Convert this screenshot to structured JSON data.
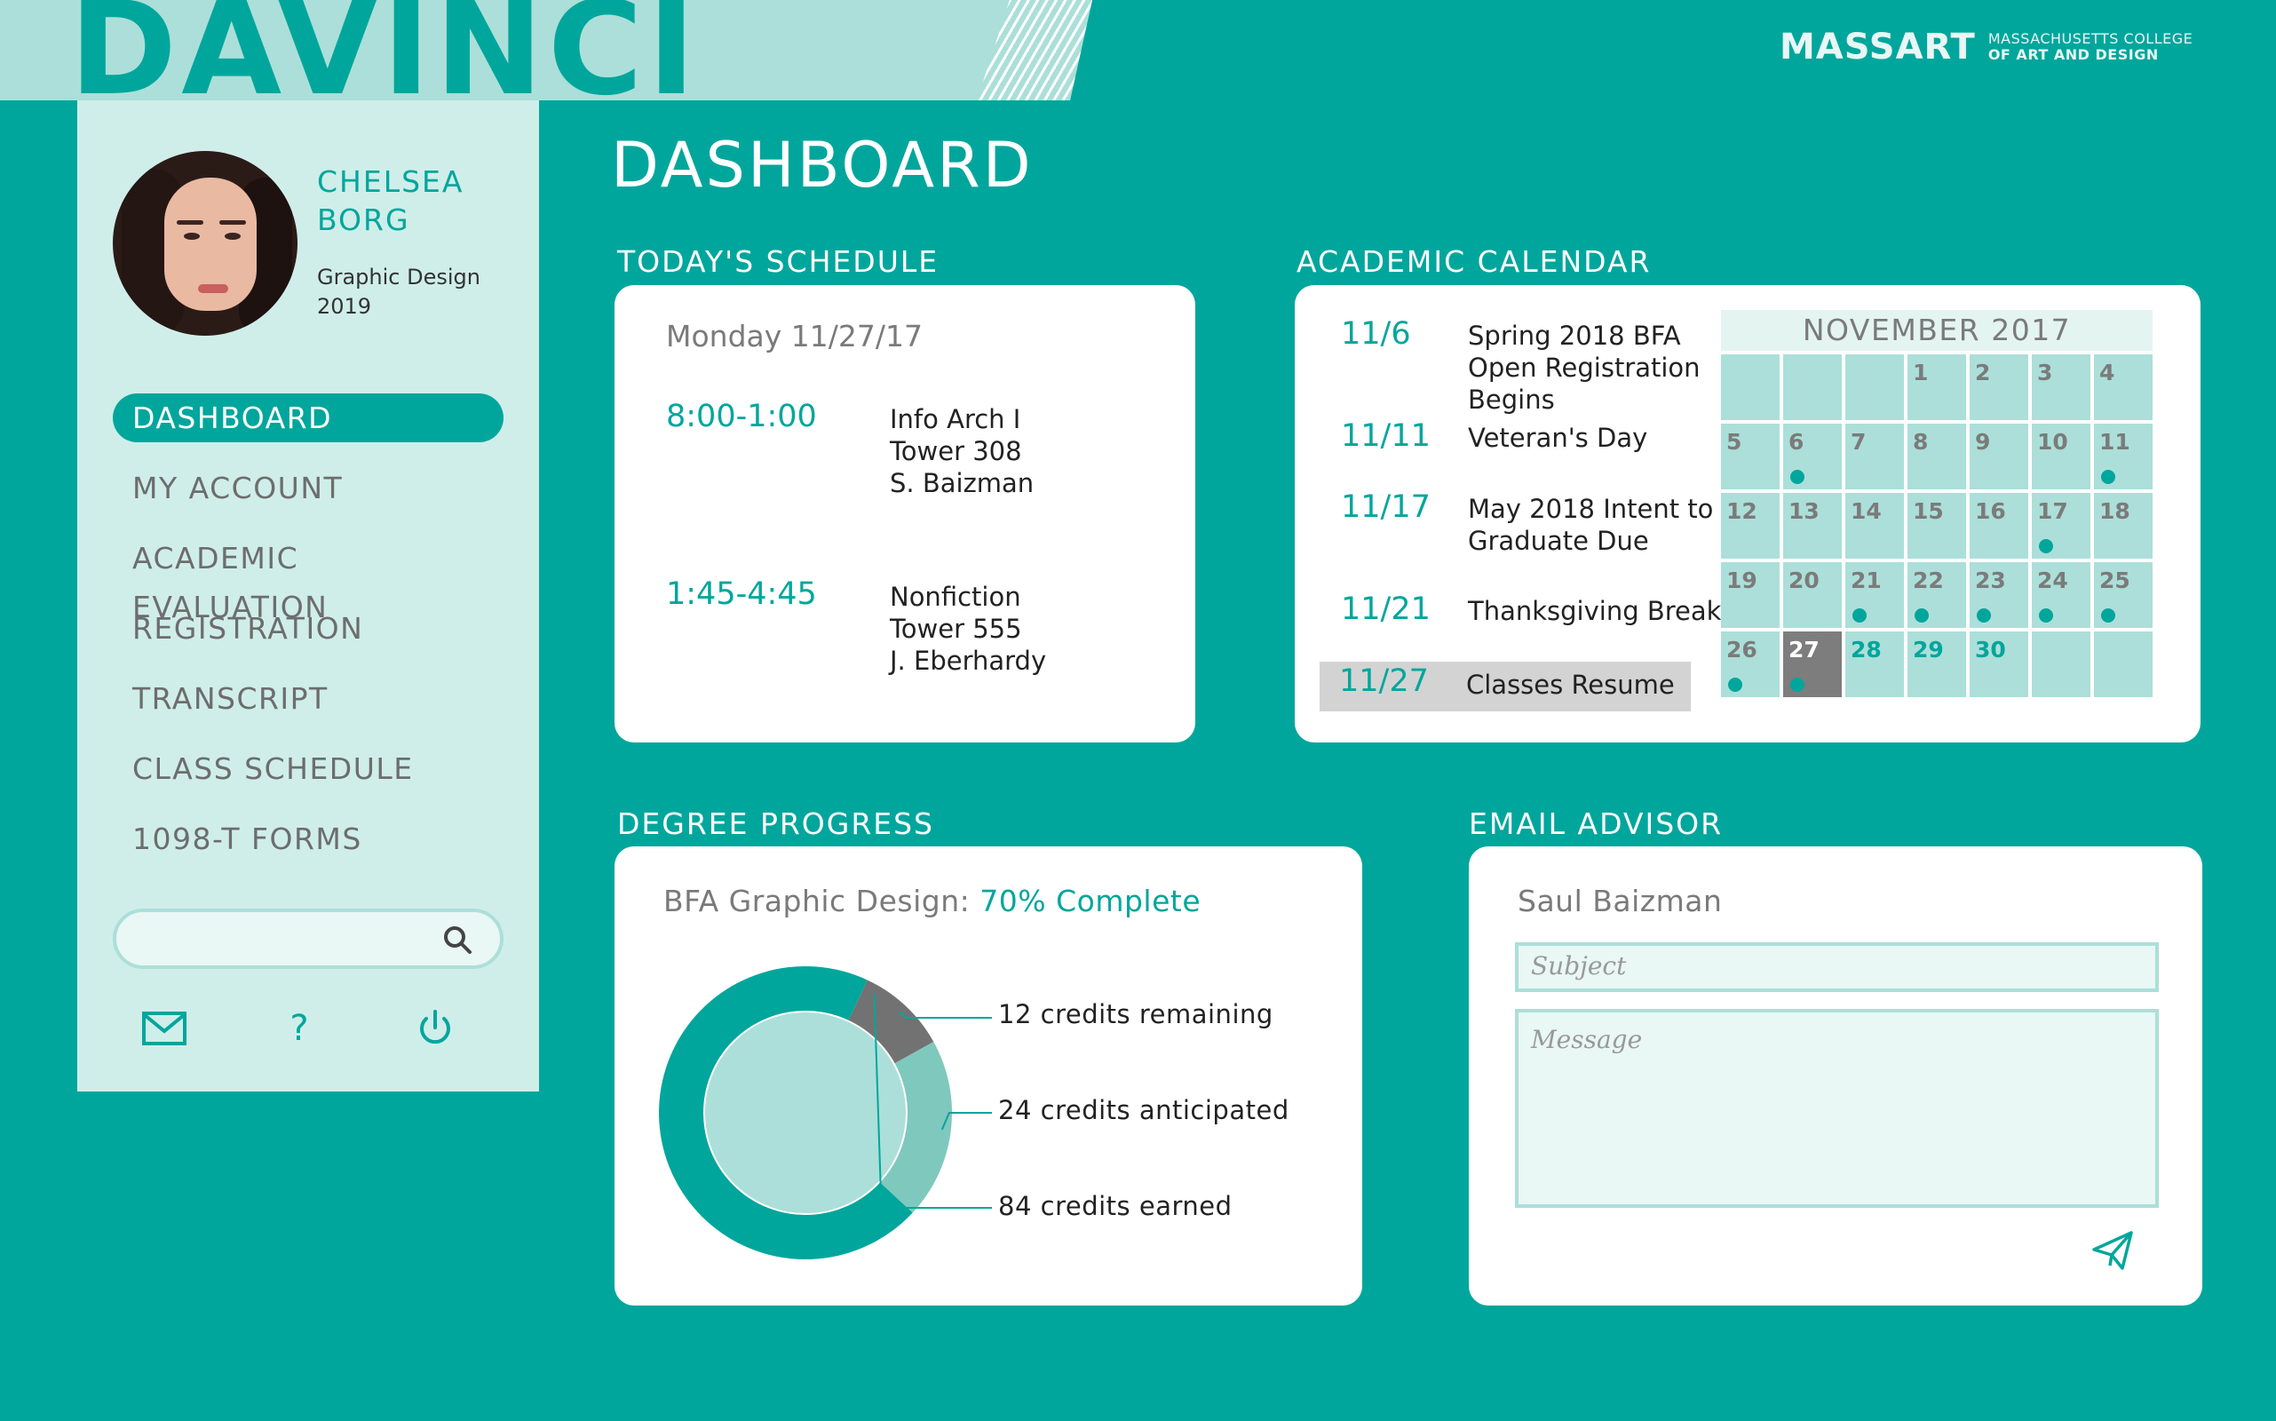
{
  "app": {
    "title": "DAVINCI",
    "brand_logo": "MASSART",
    "brand_sub_line1": "MASSACHUSETTS COLLEGE",
    "brand_sub_line2": "OF ART AND DESIGN"
  },
  "colors": {
    "teal": "#00a69c",
    "mint": "#acdfd9",
    "sidebar": "#cfeeea",
    "gray": "#7d7d7d"
  },
  "profile": {
    "first_name": "CHELSEA",
    "last_name": "BORG",
    "program": "Graphic Design",
    "year": "2019"
  },
  "sidebar": {
    "items": [
      {
        "label": "DASHBOARD",
        "active": true
      },
      {
        "label": "MY ACCOUNT"
      },
      {
        "label": "ACADEMIC EVALUATION"
      },
      {
        "label": "REGISTRATION"
      },
      {
        "label": "TRANSCRIPT"
      },
      {
        "label": "CLASS SCHEDULE"
      },
      {
        "label": "1098-T FORMS"
      }
    ],
    "search_value": "",
    "icons": [
      "mail-icon",
      "help-icon",
      "power-icon"
    ],
    "help_glyph": "?"
  },
  "page": {
    "title": "DASHBOARD"
  },
  "schedule": {
    "title": "TODAY'S SCHEDULE",
    "date": "Monday 11/27/17",
    "classes": [
      {
        "time": "8:00-1:00",
        "course": "Info Arch I",
        "room": "Tower 308",
        "instructor": "S. Baizman"
      },
      {
        "time": "1:45-4:45",
        "course": "Nonfiction",
        "room": "Tower 555",
        "instructor": "J. Eberhardy"
      }
    ]
  },
  "calendar": {
    "title": "ACADEMIC CALENDAR",
    "events": [
      {
        "date": "11/6",
        "text": "Spring 2018 BFA Open Registration Begins"
      },
      {
        "date": "11/11",
        "text": "Veteran's Day"
      },
      {
        "date": "11/17",
        "text": "May 2018 Intent to Graduate Due"
      },
      {
        "date": "11/21",
        "text": "Thanksgiving Break"
      },
      {
        "date": "11/27",
        "text": "Classes Resume",
        "highlight": true
      }
    ],
    "month": "NOVEMBER 2017",
    "leading_blanks": 3,
    "days_in_month": 30,
    "today": 27,
    "event_days": [
      6,
      11,
      17,
      21,
      22,
      23,
      24,
      25,
      26,
      27
    ],
    "teal_days": [
      28,
      29,
      30
    ]
  },
  "degree": {
    "title": "DEGREE PROGRESS",
    "label": "BFA Graphic Design:",
    "percent_text": "70% Complete",
    "remaining_label": "12 credits remaining",
    "anticipated_label": "24 credits anticipated",
    "earned_label": "84 credits earned"
  },
  "chart_data": {
    "type": "pie",
    "categories": [
      "credits earned",
      "credits anticipated",
      "credits remaining"
    ],
    "values": [
      84,
      24,
      12
    ],
    "colors": [
      "#00a69c",
      "#7fc8bd",
      "#727272"
    ]
  },
  "email": {
    "title": "EMAIL ADVISOR",
    "advisor": "Saul Baizman",
    "subject_placeholder": "Subject",
    "message_placeholder": "Message"
  }
}
